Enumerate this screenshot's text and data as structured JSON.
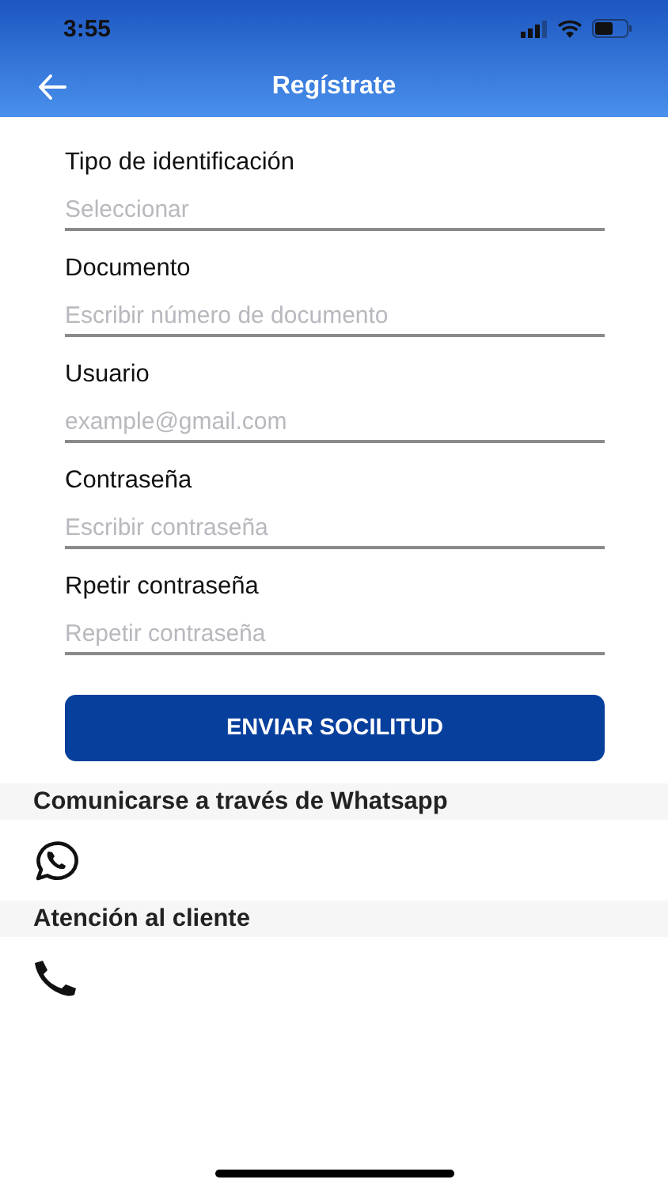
{
  "status_bar": {
    "time": "3:55"
  },
  "header": {
    "title": "Regístrate"
  },
  "fields": [
    {
      "label": "Tipo de identificación",
      "placeholder": "Seleccionar"
    },
    {
      "label": "Documento",
      "placeholder": "Escribir número de documento"
    },
    {
      "label": "Usuario",
      "placeholder": "example@gmail.com"
    },
    {
      "label": "Contraseña",
      "placeholder": "Escribir contraseña"
    },
    {
      "label": "Rpetir contraseña",
      "placeholder": "Repetir contraseña"
    }
  ],
  "submit_button": "ENVIAR SOCILITUD",
  "sections": [
    {
      "title": "Comunicarse a través de Whatsapp",
      "kind": "whatsapp"
    },
    {
      "title": "Atención al cliente",
      "kind": "phone"
    }
  ]
}
